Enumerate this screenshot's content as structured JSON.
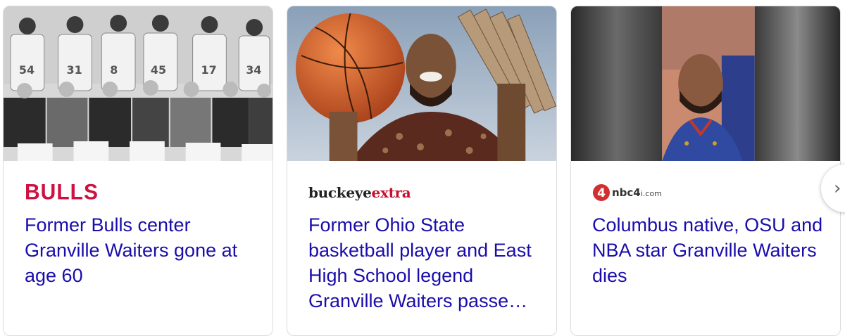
{
  "cards": [
    {
      "source": "BULLS",
      "headline": "Former Bulls center Granville Waiters gone at age 60",
      "image": "bulls-team-photo"
    },
    {
      "source_part1": "buckeye",
      "source_part2": "extra",
      "headline": "Former Ohio State basketball player and East High School legend Granville Waiters passe…",
      "image": "player-holding-basketball"
    },
    {
      "source_logo_number": "4",
      "source_main": "nbc4",
      "source_suffix": "i.com",
      "headline": "Columbus native, OSU and NBA star Granville Waiters dies",
      "image": "player-portrait"
    }
  ],
  "next_button_icon": "chevron-right-icon",
  "colors": {
    "headline": "#1a0dab",
    "bulls_red": "#ce1141",
    "buckeye_red": "#c8102e",
    "border": "#dadce0"
  }
}
